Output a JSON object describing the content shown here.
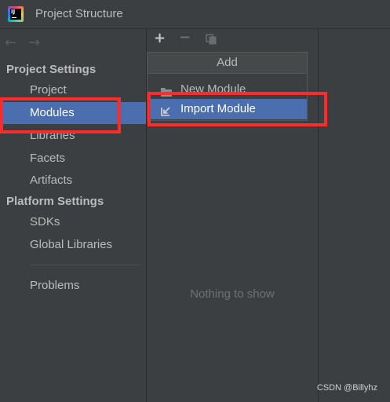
{
  "window": {
    "title": "Project Structure"
  },
  "sidebar": {
    "project_settings_header": "Project Settings",
    "project_settings_items": [
      "Project",
      "Modules",
      "Libraries",
      "Facets",
      "Artifacts"
    ],
    "platform_settings_header": "Platform Settings",
    "platform_settings_items": [
      "SDKs",
      "Global Libraries"
    ],
    "problems": "Problems",
    "selected": "Modules"
  },
  "toolbar": {
    "add_icon": "plus-icon",
    "remove_icon": "minus-icon",
    "copy_icon": "copy-icon"
  },
  "add_popup": {
    "header": "Add",
    "items": [
      "New Module",
      "Import Module"
    ],
    "selected": "Import Module"
  },
  "middle_panel": {
    "empty_text": "Nothing to show"
  },
  "watermark": "CSDN @Billyhz",
  "colors": {
    "background": "#3c3f41",
    "selection": "#4b6eaf",
    "annotation_red": "#ff2b2b"
  }
}
